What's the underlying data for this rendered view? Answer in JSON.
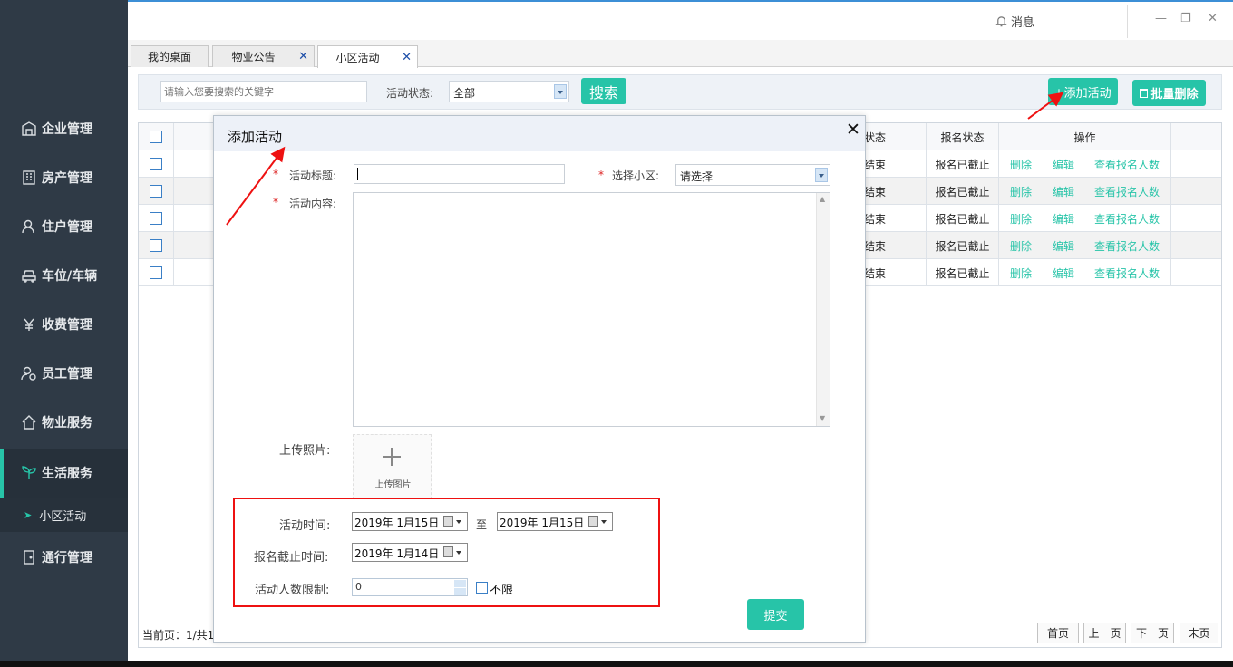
{
  "colors": {
    "accent": "#27c4a8",
    "sidebar": "#2f3a46",
    "highlight_red": "#e11"
  },
  "topbar": {
    "message_label": "消息",
    "message_icon": "bell-icon"
  },
  "window_controls": {
    "minimize": "—",
    "restore": "❐",
    "close": "✕"
  },
  "tabs": [
    {
      "label": "我的桌面",
      "closable": false
    },
    {
      "label": "物业公告",
      "closable": true
    },
    {
      "label": "小区活动",
      "closable": true,
      "active": true
    }
  ],
  "tab_close_glyph": "✕",
  "sidebar": {
    "items": [
      {
        "label": "企业管理",
        "icon": "building-icon"
      },
      {
        "label": "房产管理",
        "icon": "property-icon"
      },
      {
        "label": "住户管理",
        "icon": "residents-icon"
      },
      {
        "label": "车位/车辆",
        "icon": "car-icon"
      },
      {
        "label": "收费管理",
        "icon": "yen-icon"
      },
      {
        "label": "员工管理",
        "icon": "staff-icon"
      },
      {
        "label": "物业服务",
        "icon": "home-icon"
      },
      {
        "label": "生活服务",
        "icon": "sprout-icon",
        "active": true
      },
      {
        "label": "通行管理",
        "icon": "door-icon"
      }
    ],
    "sub_item": "小区活动"
  },
  "search": {
    "keyword_placeholder": "请输入您要搜索的关键字",
    "status_label": "活动状态:",
    "status_value": "全部",
    "search_button": "搜索",
    "add_button": "添加活动",
    "add_button_prefix": "+",
    "batch_delete_button": "批量删除"
  },
  "table": {
    "headers": {
      "activity_status": "状态",
      "signup_status": "报名状态",
      "actions": "操作"
    },
    "rows": [
      {
        "activity_status": "结束",
        "signup_status": "报名已截止"
      },
      {
        "activity_status": "结束",
        "signup_status": "报名已截止"
      },
      {
        "activity_status": "结束",
        "signup_status": "报名已截止"
      },
      {
        "activity_status": "结束",
        "signup_status": "报名已截止"
      },
      {
        "activity_status": "结束",
        "signup_status": "报名已截止"
      }
    ],
    "action_labels": {
      "delete": "删除",
      "edit": "编辑",
      "view": "查看报名人数"
    }
  },
  "pager": {
    "current_text": "当前页：1/共1",
    "first": "首页",
    "prev": "上一页",
    "next": "下一页",
    "last": "末页"
  },
  "modal": {
    "title": "添加活动",
    "close_glyph": "✕",
    "required_mark": "*",
    "fields": {
      "title_label": "活动标题:",
      "title_value": "",
      "community_label": "选择小区:",
      "community_value": "请选择",
      "content_label": "活动内容:",
      "photo_label": "上传照片:",
      "upload_hint": "上传图片",
      "time_label": "活动时间:",
      "time_start": "2019年 1月15日",
      "time_sep": "至",
      "time_end": "2019年 1月15日",
      "deadline_label": "报名截止时间:",
      "deadline_value": "2019年 1月14日",
      "limit_label": "活动人数限制:",
      "limit_value": "0",
      "unlimited_label": "不限"
    },
    "submit": "提交"
  }
}
